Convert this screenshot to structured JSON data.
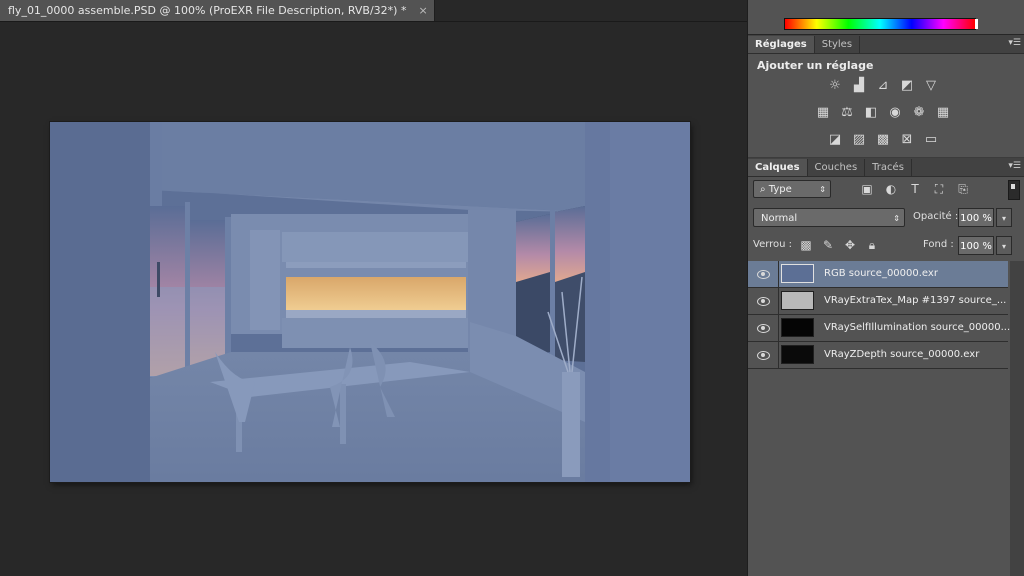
{
  "document": {
    "tab_title": "fly_01_0000 assemble.PSD @ 100% (ProEXR File Description, RVB/32*) *",
    "close_glyph": "×"
  },
  "adjustments_panel": {
    "tabs": [
      {
        "label": "Réglages",
        "active": true
      },
      {
        "label": "Styles",
        "active": false
      }
    ],
    "title": "Ajouter un réglage",
    "icons_row1": [
      "brightness-contrast-icon",
      "levels-icon",
      "curves-icon",
      "exposure-icon",
      "vibrance-icon"
    ],
    "icons_row2": [
      "hue-saturation-icon",
      "color-balance-icon",
      "black-white-icon",
      "photo-filter-icon",
      "channel-mixer-icon",
      "color-lookup-icon"
    ],
    "icons_row3": [
      "invert-icon",
      "posterize-icon",
      "threshold-icon",
      "selective-color-icon",
      "gradient-map-icon"
    ]
  },
  "layers_panel": {
    "tabs": [
      {
        "label": "Calques",
        "active": true
      },
      {
        "label": "Couches",
        "active": false
      },
      {
        "label": "Tracés",
        "active": false
      }
    ],
    "filter_label": "Type",
    "blend_mode": "Normal",
    "opacity_label": "Opacité :",
    "opacity_value": "100 %",
    "lock_label": "Verrou :",
    "fill_label": "Fond :",
    "fill_value": "100 %",
    "layers": [
      {
        "name": "RGB source_00000.exr",
        "selected": true,
        "thumb": "#5c6f95"
      },
      {
        "name": "VRayExtraTex_Map #1397 source_...",
        "selected": false,
        "thumb": "#b9b9b9"
      },
      {
        "name": "VRaySelfIllumination source_00000...",
        "selected": false,
        "thumb": "#050505"
      },
      {
        "name": "VRayZDepth source_00000.exr",
        "selected": false,
        "thumb": "#0a0a0a"
      }
    ]
  },
  "colors": {
    "accent_selection": "#6b7c96",
    "panel_bg": "#535353",
    "workspace_bg": "#282828"
  }
}
